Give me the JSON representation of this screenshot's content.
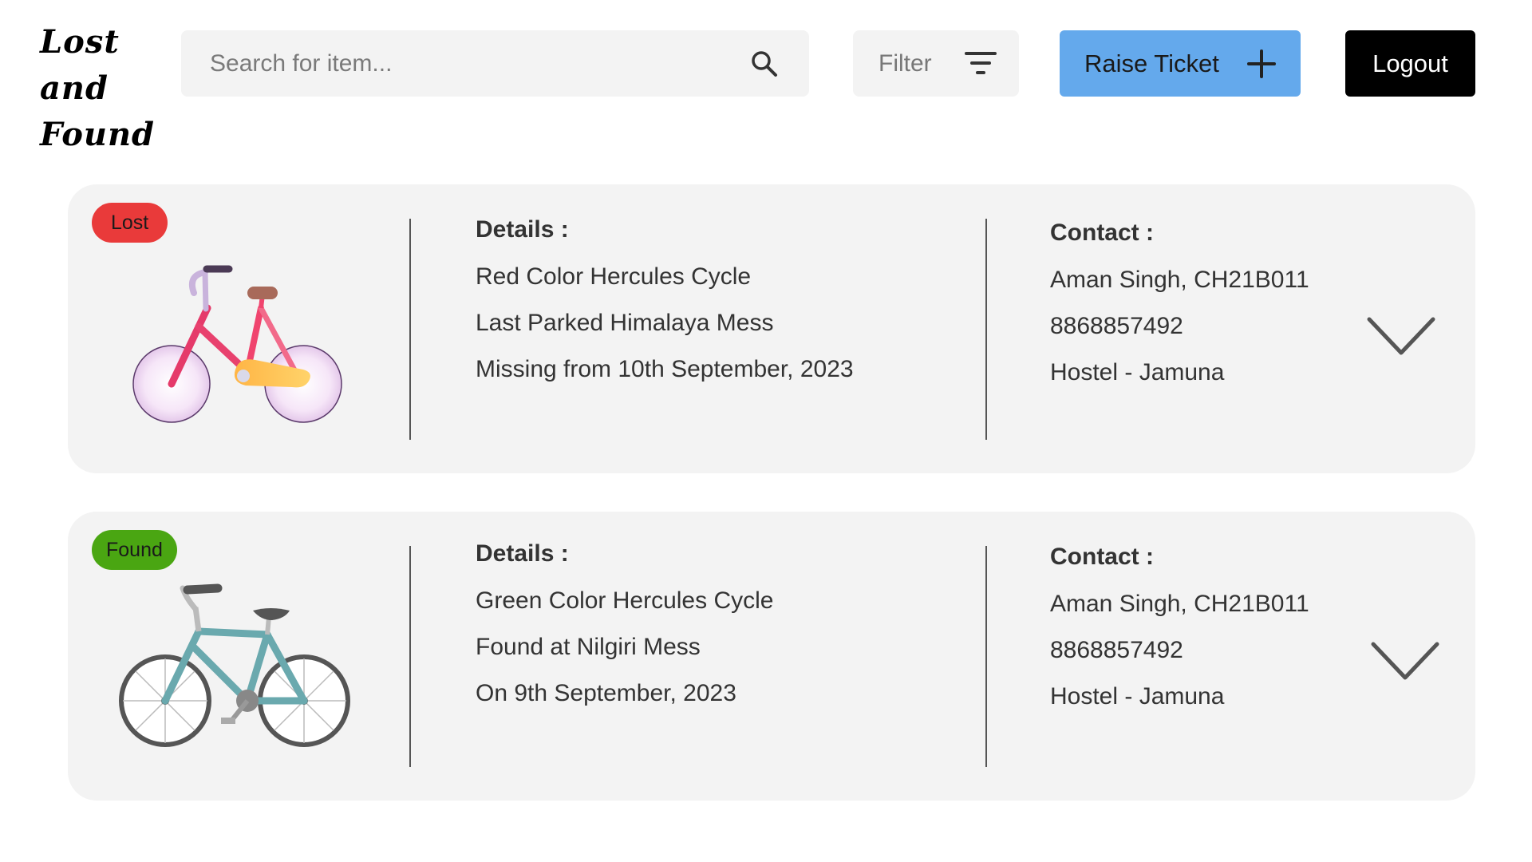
{
  "logo": {
    "lines": [
      "Lost",
      "and",
      "Found"
    ]
  },
  "search": {
    "placeholder": "Search for item...",
    "icon": "search-icon"
  },
  "filter": {
    "label": "Filter",
    "icon": "filter-icon"
  },
  "raise_ticket": {
    "label": "Raise Ticket",
    "icon": "plus-icon"
  },
  "logout": {
    "label": "Logout"
  },
  "colors": {
    "accent_blue": "#64a9ec",
    "lost_badge": "#e93a3a",
    "found_badge": "#4aa612",
    "card_bg": "#f3f3f3"
  },
  "items": [
    {
      "status": "Lost",
      "image_icon": "red-bicycle-icon",
      "details_heading": "Details :",
      "details": [
        "Red Color Hercules Cycle",
        "Last Parked Himalaya Mess",
        "Missing from 10th September, 2023"
      ],
      "contact_heading": "Contact :",
      "contact": [
        "Aman Singh, CH21B011",
        "8868857492",
        "Hostel - Jamuna"
      ]
    },
    {
      "status": "Found",
      "image_icon": "teal-bicycle-icon",
      "details_heading": "Details :",
      "details": [
        "Green Color Hercules Cycle",
        "Found at Nilgiri Mess",
        "On 9th September, 2023"
      ],
      "contact_heading": "Contact :",
      "contact": [
        "Aman Singh, CH21B011",
        "8868857492",
        "Hostel - Jamuna"
      ]
    }
  ]
}
